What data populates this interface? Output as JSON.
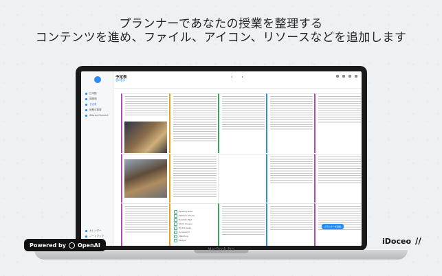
{
  "headline": {
    "line1": "プランナーであなたの授業を整理する",
    "line2": "コンテンツを進め、ファイル、アイコン、リソースなどを追加します"
  },
  "device": {
    "name": "MacBook Pro"
  },
  "app": {
    "title": "予定表",
    "subtitle": "週の表示",
    "sidebar": [
      {
        "label": "日本語",
        "active": false
      },
      {
        "label": "時間割",
        "active": false
      },
      {
        "label": "予定表",
        "active": true
      },
      {
        "label": "授業の整理",
        "active": false
      },
      {
        "label": "iDoceo Connect",
        "active": false
      }
    ],
    "sidebar_bottom": [
      "カレンダー",
      "ノートブック"
    ],
    "toolbar_icons": [
      "search-icon",
      "grid-icon",
      "settings-icon",
      "share-icon"
    ],
    "checklist": [
      "Spelling Bees",
      "Multiple Choice",
      "Realistic Test",
      "Short Answer",
      "Fill the gaps",
      "Crossword",
      "Matching",
      "Essays"
    ],
    "cta_button": "プランナーを追加",
    "colors": {
      "accent": "#2d8cf0",
      "col1": "#b04ab0",
      "col2": "#e0a020",
      "col3": "#3aa55a",
      "col4": "#2d8cf0",
      "col5": "#b04ab0"
    }
  },
  "badges": {
    "powered_by": "Powered by",
    "openai": "OpenAI",
    "brand": "iDoceo"
  }
}
